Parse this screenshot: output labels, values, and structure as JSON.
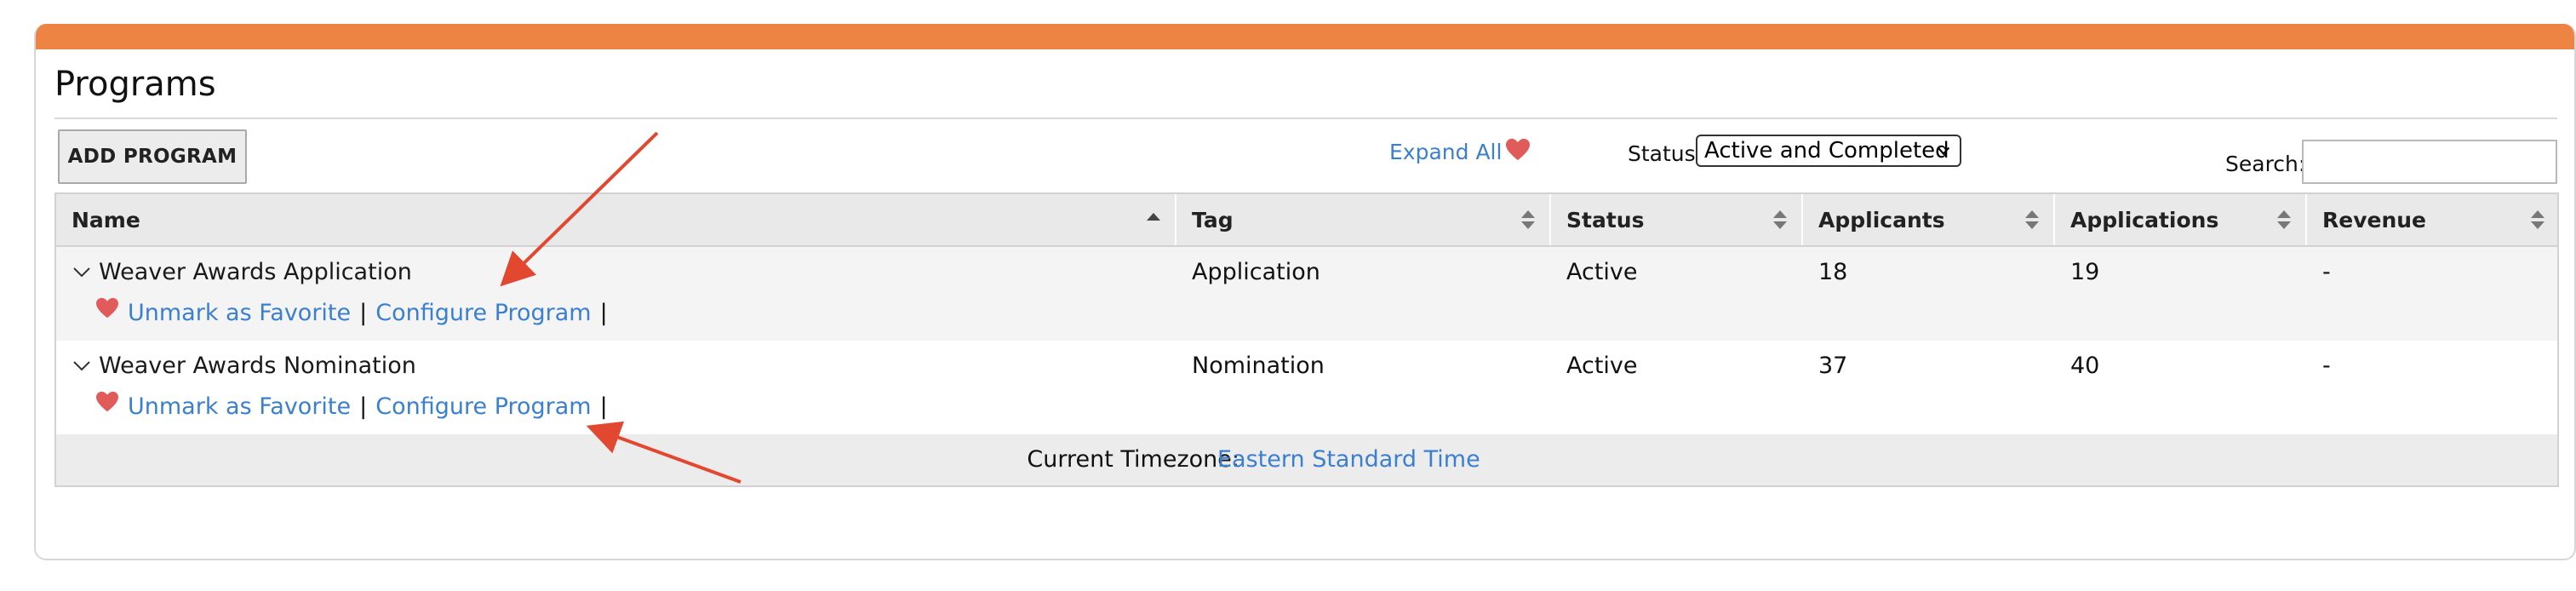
{
  "page": {
    "title": "Programs"
  },
  "toolbar": {
    "add_program_label": "ADD PROGRAM",
    "expand_all_label": "Expand All",
    "status_label": "Status",
    "status_value": "Active and Completed",
    "search_label": "Search:",
    "search_value": ""
  },
  "table": {
    "columns": [
      "Name",
      "Tag",
      "Status",
      "Applicants",
      "Applications",
      "Revenue"
    ],
    "rows": [
      {
        "name": "Weaver Awards Application",
        "tag": "Application",
        "status": "Active",
        "applicants": "18",
        "applications": "19",
        "revenue": "-",
        "unmark_label": "Unmark as Favorite",
        "configure_label": "Configure Program",
        "sep": "|"
      },
      {
        "name": "Weaver Awards Nomination",
        "tag": "Nomination",
        "status": "Active",
        "applicants": "37",
        "applications": "40",
        "revenue": "-",
        "unmark_label": "Unmark as Favorite",
        "configure_label": "Configure Program",
        "sep": "|"
      }
    ],
    "timezone_label": "Current Timezone:",
    "timezone_value": "Eastern Standard Time"
  },
  "colors": {
    "accent_bar": "#ee8443",
    "link": "#3a7fd0",
    "heart": "#e25b5b",
    "annotation_arrow": "#e2472f"
  },
  "icons": [
    "heart-icon",
    "chevron-down-icon",
    "sort-icon",
    "sort-asc-icon",
    "expand-toggle-icon"
  ]
}
